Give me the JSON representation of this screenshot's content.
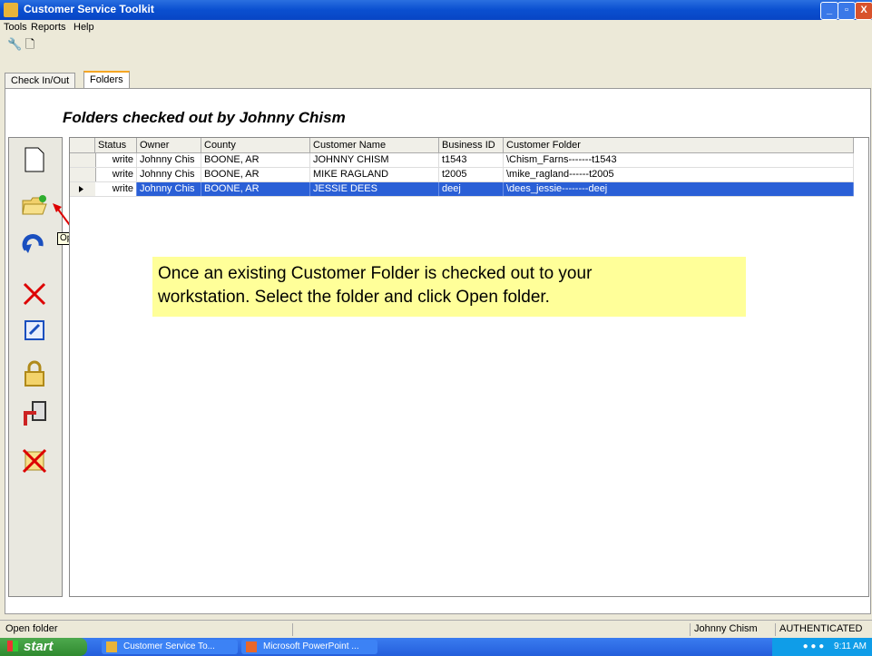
{
  "window": {
    "title": "Customer Service Toolkit"
  },
  "menu": [
    "Tools",
    "Reports",
    "Help"
  ],
  "tabs": [
    {
      "label": "Check In/Out"
    },
    {
      "label": "Folders"
    }
  ],
  "heading": "Folders checked out by Johnny Chism",
  "grid": {
    "columns": [
      "Status",
      "Owner",
      "County",
      "Customer Name",
      "Business ID",
      "Customer Folder"
    ],
    "rows": [
      {
        "status": "write",
        "owner": "Johnny Chis",
        "county": "BOONE, AR",
        "customer_name": "JOHNNY CHISM",
        "business_id": "t1543",
        "customer_folder": "\\Chism_Farns-------t1543"
      },
      {
        "status": "write",
        "owner": "Johnny Chis",
        "county": "BOONE, AR",
        "customer_name": "MIKE RAGLAND",
        "business_id": "t2005",
        "customer_folder": "\\mike_ragland------t2005"
      },
      {
        "status": "write",
        "owner": "Johnny Chis",
        "county": "BOONE, AR",
        "customer_name": "JESSIE DEES",
        "business_id": "deej",
        "customer_folder": "\\dees_jessie--------deej"
      }
    ]
  },
  "tooltip": "Open folder",
  "callout": {
    "line1": "Once an existing Customer Folder is checked out to your",
    "line2": "workstation. Select the folder and click Open folder."
  },
  "status_bar": {
    "left": "Open folder",
    "user": "Johnny Chism",
    "auth": "AUTHENTICATED"
  },
  "taskbar": {
    "start": "start",
    "tasks": [
      "Customer Service To...",
      "Microsoft PowerPoint ..."
    ],
    "clock": "9:11 AM"
  },
  "colors": {
    "selection": "#2a5fd6",
    "callout": "#ffff99",
    "titlebar": "#0a4fd0"
  }
}
